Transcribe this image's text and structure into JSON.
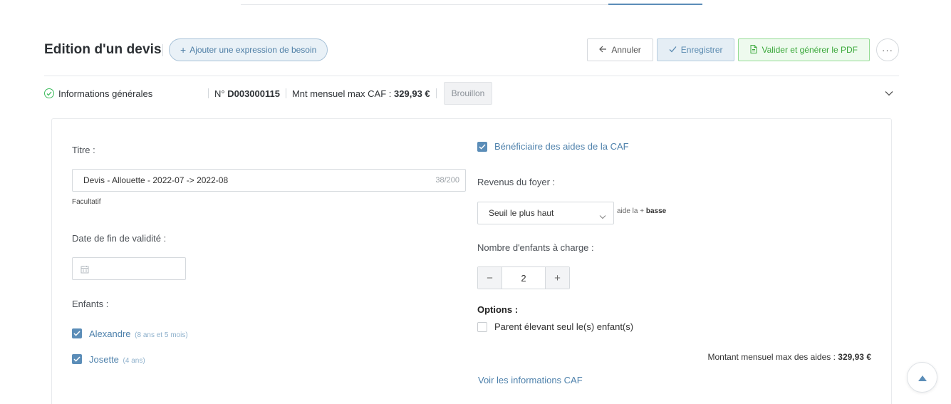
{
  "header": {
    "title": "Edition d'un devis",
    "add_need_label": "Ajouter une expression de besoin",
    "cancel_label": "Annuler",
    "save_label": "Enregistrer",
    "validate_label": "Valider et générer le PDF",
    "more_label": "···"
  },
  "info_bar": {
    "section_label": "Informations générales",
    "number_prefix": "N°",
    "number": "D003000115",
    "caf_max_prefix": "Mnt mensuel max CAF :",
    "caf_max_value": "329,93 €",
    "status": "Brouillon"
  },
  "form": {
    "title_label": "Titre :",
    "title_value": "Devis - Allouette - 2022-07 -> 2022-08",
    "title_count": "38/200",
    "title_hint": "Facultatif",
    "validity_label": "Date de fin de validité :",
    "validity_value": "",
    "children_label": "Enfants :",
    "children": [
      {
        "name": "Alexandre",
        "age": "(8 ans et 5 mois)",
        "checked": true
      },
      {
        "name": "Josette",
        "age": "(4 ans)",
        "checked": true
      }
    ]
  },
  "caf": {
    "beneficiary_label": "Bénéficiaire des aides de la CAF",
    "beneficiary_checked": true,
    "income_label": "Revenus du foyer :",
    "income_value": "Seuil le plus haut",
    "aid_hint_prefix": "aide la +",
    "aid_hint_bold": "basse",
    "children_count_label": "Nombre d'enfants à charge :",
    "children_count": "2",
    "minus": "−",
    "plus": "+",
    "options_title": "Options :",
    "single_parent_label": "Parent élevant seul le(s) enfant(s)",
    "single_parent_checked": false,
    "amount_prefix": "Montant mensuel max des aides :",
    "amount_value": "329,93 €",
    "info_link": "Voir les informations CAF"
  },
  "colors": {
    "accent": "#5b8db8",
    "success": "#3aa83a",
    "border": "#d5d9dd"
  }
}
